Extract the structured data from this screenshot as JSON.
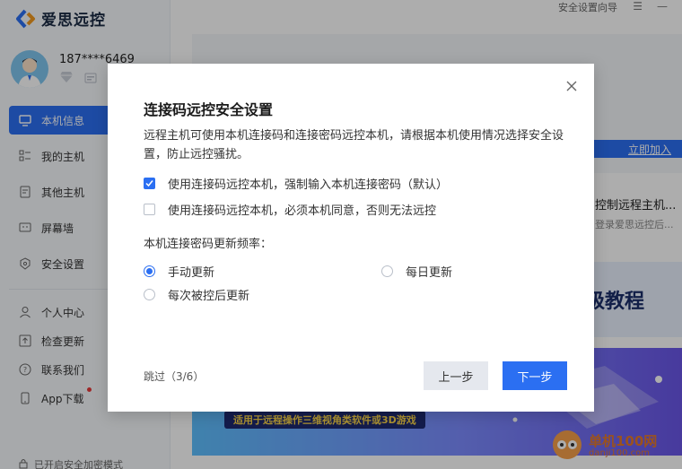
{
  "app": {
    "name": "爱思远控",
    "brand_color": "#2b6ff2"
  },
  "user": {
    "phone": "187****6469"
  },
  "sidebar": {
    "items": [
      {
        "label": "本机信息",
        "icon": "monitor-icon",
        "active": true
      },
      {
        "label": "我的主机",
        "icon": "grid-icon"
      },
      {
        "label": "其他主机",
        "icon": "document-icon"
      },
      {
        "label": "屏幕墙",
        "icon": "screen-wall-icon"
      },
      {
        "label": "安全设置",
        "icon": "shield-icon"
      }
    ],
    "secondary": [
      {
        "label": "个人中心",
        "icon": "person-icon"
      },
      {
        "label": "检查更新",
        "icon": "upload-icon"
      },
      {
        "label": "联系我们",
        "icon": "question-icon"
      },
      {
        "label": "App下载",
        "icon": "phone-icon"
      }
    ],
    "footer_status": "已开启安全加密模式"
  },
  "topbar": {
    "guide_label": "安全设置向导",
    "menu_icon": "☰",
    "minimize_icon": "—"
  },
  "main": {
    "join_link": "立即加入",
    "card_title": "控制远程主机...",
    "card_subtitle": "登录爱思远控后...",
    "banner_title": "级教程",
    "banner_strip": "适用于远程操作三维视角类软件或3D游戏",
    "watermark_text": "单机100网",
    "watermark_url": "danji100.com"
  },
  "dialog": {
    "title": "连接码远控安全设置",
    "description": "远程主机可使用本机连接码和连接密码远控本机，请根据本机使用情况选择安全设置，防止远控骚扰。",
    "options": [
      {
        "label": "使用连接码远控本机，强制输入本机连接密码（默认）",
        "checked": true
      },
      {
        "label": "使用连接码远控本机，必须本机同意，否则无法远控",
        "checked": false
      }
    ],
    "frequency_label": "本机连接密码更新频率：",
    "frequency_options": [
      {
        "label": "手动更新",
        "selected": true
      },
      {
        "label": "每日更新",
        "selected": false
      },
      {
        "label": "每次被控后更新",
        "selected": false
      }
    ],
    "skip_label": "跳过（3/6）",
    "prev_button": "上一步",
    "next_button": "下一步"
  }
}
